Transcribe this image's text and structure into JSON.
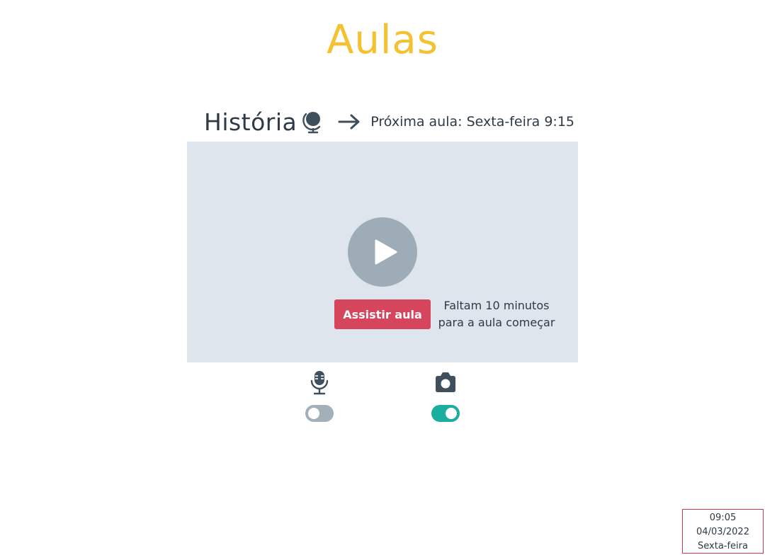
{
  "page": {
    "title": "Aulas"
  },
  "lesson": {
    "subject": "História",
    "subject_icon": "globe-icon",
    "next_class": "Próxima aula: Sexta-feira 9:15",
    "watch_button_label": "Assistir aula",
    "countdown_line1": "Faltam 10 minutos",
    "countdown_line2": "para a aula começar"
  },
  "devices": {
    "microphone": {
      "icon": "microphone-icon",
      "enabled": false
    },
    "camera": {
      "icon": "camera-icon",
      "enabled": true
    }
  },
  "clock": {
    "time": "09:05",
    "date": "04/03/2022",
    "weekday": "Sexta-feira"
  },
  "colors": {
    "title": "#f4c130",
    "text": "#2d3a47",
    "panel": "#dfe5ec",
    "play": "#9eacb7",
    "watch_button": "#d5455c",
    "toggle_on": "#1aae9f",
    "toggle_off": "#a3afb9",
    "clock_border": "#c8374f"
  }
}
